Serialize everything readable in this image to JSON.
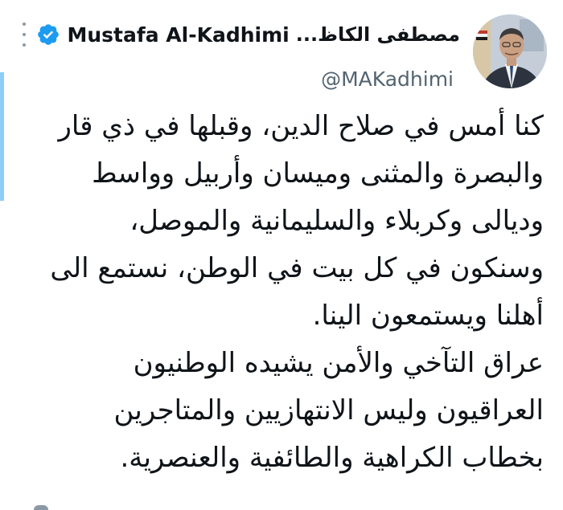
{
  "tweet": {
    "author": {
      "arabic_name": "مصطفى الكاظ...",
      "display_name": "Mustafa Al-Kadhimi",
      "handle": "@MAKadhimi",
      "verified_icon": "verified-badge-icon",
      "more_icon": "more-vertical-icon"
    },
    "lines": [
      "كنا أمس في صلاح الدين، وقبلها في ذي قار",
      "والبصرة والمثنى وميسان وأربيل وواسط",
      "وديالى وكربلاء والسليمانية والموصل،",
      "وسنكون في كل بيت في الوطن، نستمع الى",
      "أهلنا ويستمعون الينا.",
      "عراق التآخي والأمن يشيده الوطنيون",
      "العراقيون وليس الانتهازيين والمتاجرين",
      "بخطاب الكراهية والطائفية والعنصرية."
    ]
  },
  "colors": {
    "verified": "#1d9bf0",
    "accent_bar": "#8ecdf8",
    "text": "#0f1419",
    "muted": "#536471"
  }
}
